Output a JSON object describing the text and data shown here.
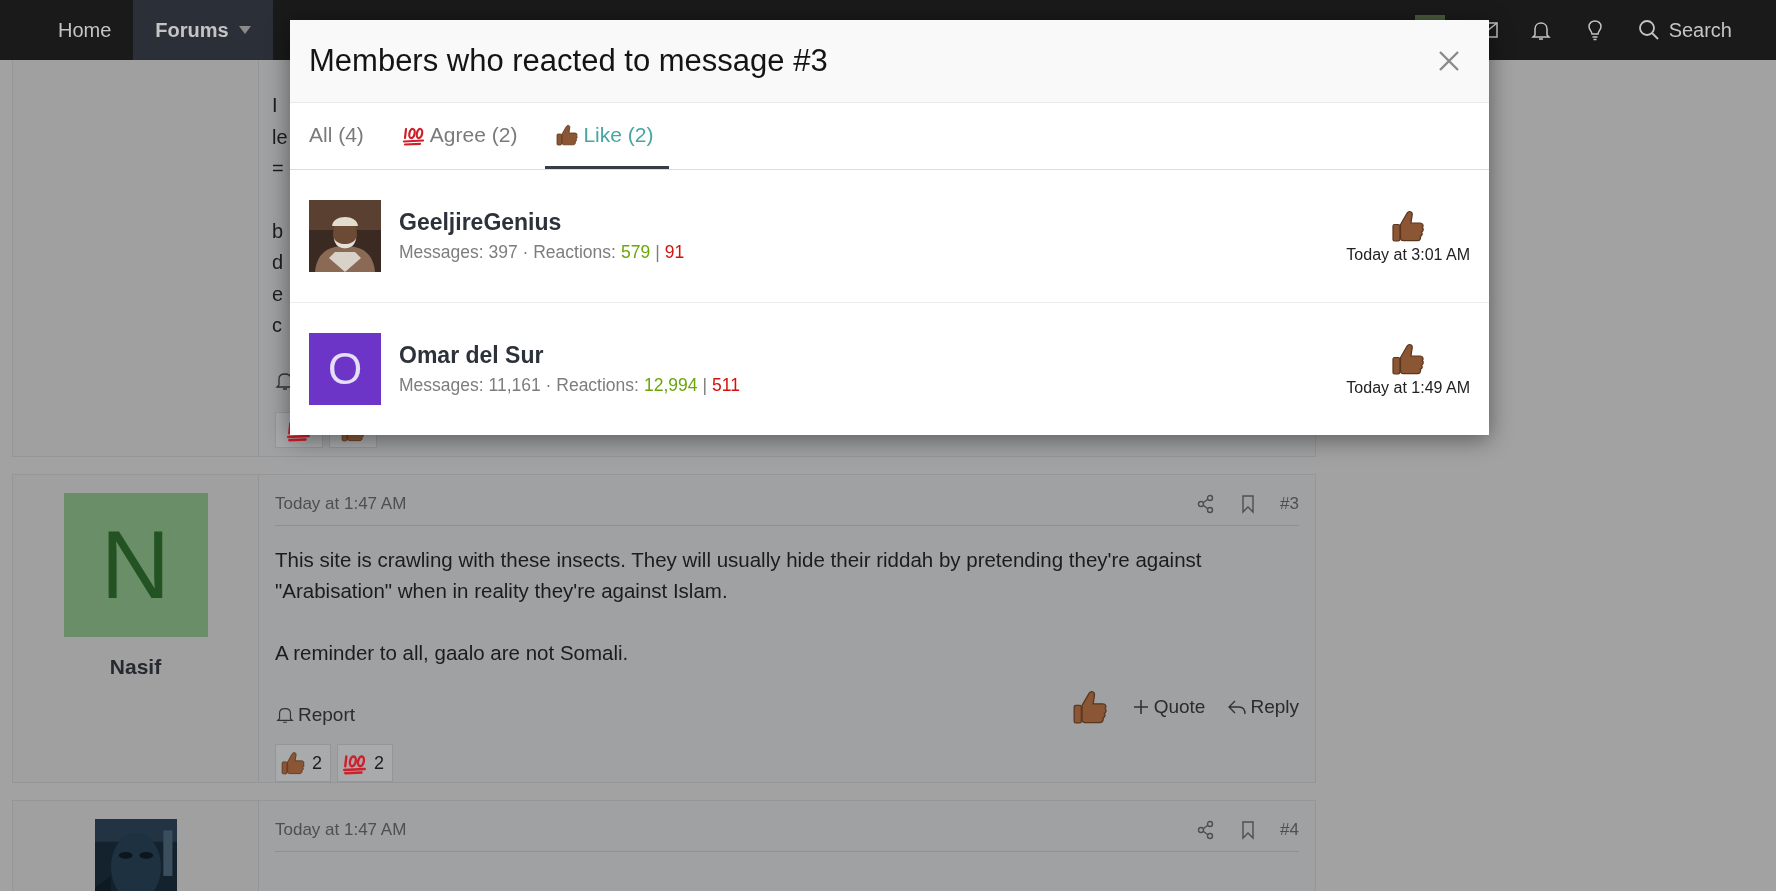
{
  "nav": {
    "items": [
      {
        "label": "Home",
        "selected": false,
        "has_menu": false
      },
      {
        "label": "Forums",
        "selected": true,
        "has_menu": true
      }
    ],
    "search": {
      "label": "Search"
    }
  },
  "posts": [
    {
      "kind": "partial",
      "fragments": [
        [
          "I",
          "le",
          "="
        ],
        [
          "b",
          "d",
          "e",
          "c"
        ]
      ],
      "reactions": [
        {
          "kind": "hundred"
        },
        {
          "kind": "like"
        }
      ]
    },
    {
      "kind": "full",
      "author": "Nasif",
      "avatar": {
        "kind": "letter",
        "letter": "N",
        "color": "#6a8f68"
      },
      "date": "Today at 1:47 AM",
      "number": "#3",
      "paragraphs": [
        "This site is crawling with these insects. They will usually hide their riddah by pretending they're against \"Arabisation\" when in reality they're against Islam.",
        "A reminder to all, gaalo are not Somali."
      ],
      "report": "Report",
      "quote": "Quote",
      "reply": "Reply",
      "reactions": [
        {
          "kind": "like",
          "count": "2"
        },
        {
          "kind": "hundred",
          "count": "2"
        }
      ]
    },
    {
      "kind": "cut",
      "date": "Today at 1:47 AM",
      "number": "#4"
    }
  ],
  "modal": {
    "title": "Members who reacted to message #3",
    "tabs": [
      {
        "label": "All (4)",
        "kind": "all",
        "selected": false
      },
      {
        "label": "Agree (2)",
        "kind": "hundred",
        "selected": false
      },
      {
        "label": "Like (2)",
        "kind": "like",
        "selected": true
      }
    ],
    "members": [
      {
        "name": "GeeljireGenius",
        "stats": "Messages: 397 · Reactions:",
        "positive": "579",
        "separator": "|",
        "negative": "91",
        "time": "Today at 3:01 AM"
      },
      {
        "name": "Omar del Sur",
        "avatar": {
          "kind": "letter",
          "letter": "O",
          "color": "#6c35c8"
        },
        "stats": "Messages: 11,161 · Reactions:",
        "positive": "12,994",
        "separator": "|",
        "negative": "511",
        "time": "Today at 1:49 AM"
      }
    ]
  }
}
